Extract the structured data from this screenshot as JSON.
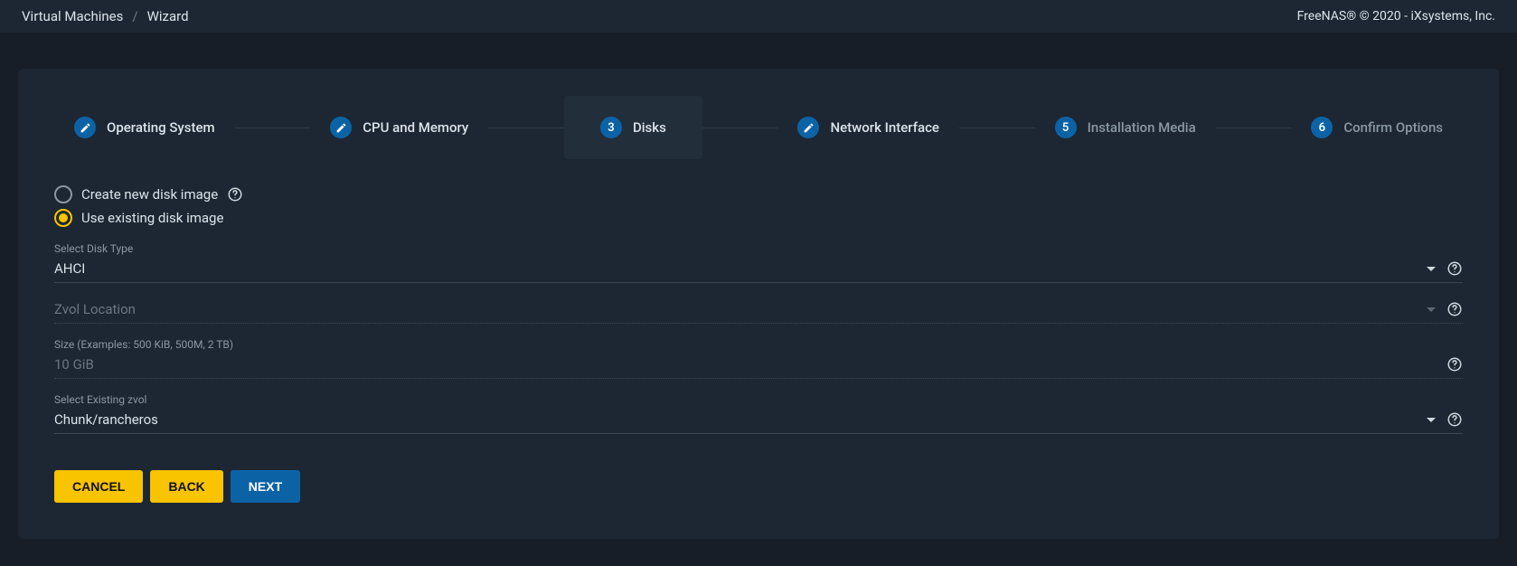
{
  "breadcrumb": {
    "parent": "Virtual Machines",
    "current": "Wizard"
  },
  "copyright": "FreeNAS® © 2020 - iXsystems, Inc.",
  "stepper": {
    "steps": [
      {
        "label": "Operating System",
        "state": "done",
        "icon": "edit"
      },
      {
        "label": "CPU and Memory",
        "state": "done",
        "icon": "edit"
      },
      {
        "label": "Disks",
        "state": "current",
        "number": "3"
      },
      {
        "label": "Network Interface",
        "state": "done",
        "icon": "edit"
      },
      {
        "label": "Installation Media",
        "state": "future",
        "number": "5"
      },
      {
        "label": "Confirm Options",
        "state": "future",
        "number": "6"
      }
    ]
  },
  "form": {
    "radios": {
      "create": "Create new disk image",
      "existing": "Use existing disk image",
      "selected": "existing"
    },
    "diskType": {
      "label": "Select Disk Type",
      "value": "AHCI"
    },
    "zvolLocation": {
      "label": "Zvol Location",
      "value": ""
    },
    "size": {
      "label": "Size (Examples: 500 KiB, 500M, 2 TB)",
      "value": "10 GiB"
    },
    "existingZvol": {
      "label": "Select Existing zvol",
      "value": "Chunk/rancheros"
    }
  },
  "buttons": {
    "cancel": "CANCEL",
    "back": "BACK",
    "next": "NEXT"
  }
}
